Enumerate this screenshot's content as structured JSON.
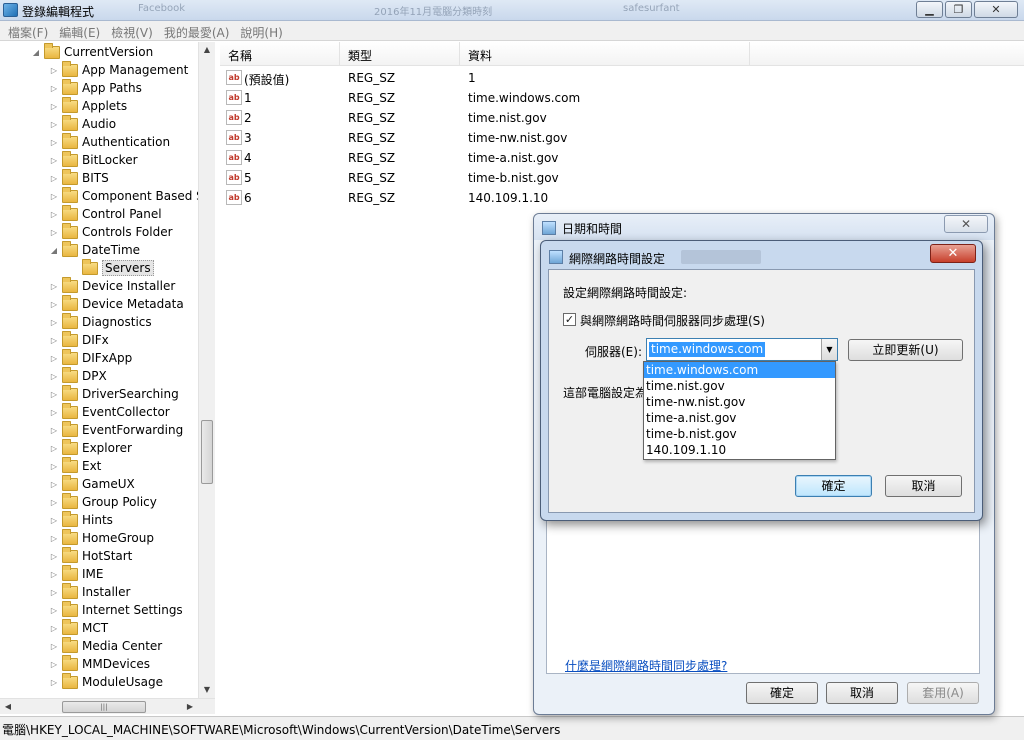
{
  "window": {
    "title": "登錄編輯程式",
    "ghost_tabs": [
      "Facebook",
      "2016年11月電腦分類時刻",
      "safesurfant"
    ]
  },
  "menu": [
    "檔案(F)",
    "編輯(E)",
    "檢視(V)",
    "我的最愛(A)",
    "說明(H)"
  ],
  "tree": {
    "root": "CurrentVersion",
    "items": [
      "App Management",
      "App Paths",
      "Applets",
      "Audio",
      "Authentication",
      "BitLocker",
      "BITS",
      "Component Based S",
      "Control Panel",
      "Controls Folder",
      "DateTime",
      "Servers",
      "Device Installer",
      "Device Metadata",
      "Diagnostics",
      "DIFx",
      "DIFxApp",
      "DPX",
      "DriverSearching",
      "EventCollector",
      "EventForwarding",
      "Explorer",
      "Ext",
      "GameUX",
      "Group Policy",
      "Hints",
      "HomeGroup",
      "HotStart",
      "IME",
      "Installer",
      "Internet Settings",
      "MCT",
      "Media Center",
      "MMDevices",
      "ModuleUsage"
    ]
  },
  "list": {
    "headers": [
      "名稱",
      "類型",
      "資料"
    ],
    "rows": [
      {
        "name": "(預設值)",
        "type": "REG_SZ",
        "data": "1"
      },
      {
        "name": "1",
        "type": "REG_SZ",
        "data": "time.windows.com"
      },
      {
        "name": "2",
        "type": "REG_SZ",
        "data": "time.nist.gov"
      },
      {
        "name": "3",
        "type": "REG_SZ",
        "data": "time-nw.nist.gov"
      },
      {
        "name": "4",
        "type": "REG_SZ",
        "data": "time-a.nist.gov"
      },
      {
        "name": "5",
        "type": "REG_SZ",
        "data": "time-b.nist.gov"
      },
      {
        "name": "6",
        "type": "REG_SZ",
        "data": "140.109.1.10"
      }
    ]
  },
  "status": "電腦\\HKEY_LOCAL_MACHINE\\SOFTWARE\\Microsoft\\Windows\\CurrentVersion\\DateTime\\Servers",
  "datetime_dialog": {
    "title": "日期和時間",
    "link": "什麼是網際網路時間同步處理?",
    "ok": "確定",
    "cancel": "取消",
    "apply": "套用(A)"
  },
  "ntp_dialog": {
    "title": "網際網路時間設定",
    "heading": "設定網際網路時間設定:",
    "sync_label": "與網際網路時間伺服器同步處理(S)",
    "sync_checked": true,
    "server_label": "伺服器(E):",
    "server_value": "time.windows.com",
    "update_now": "立即更新(U)",
    "this_pc": "這部電腦設定為",
    "ok": "確定",
    "cancel": "取消",
    "options": [
      "time.windows.com",
      "time.nist.gov",
      "time-nw.nist.gov",
      "time-a.nist.gov",
      "time-b.nist.gov",
      "140.109.1.10"
    ]
  }
}
